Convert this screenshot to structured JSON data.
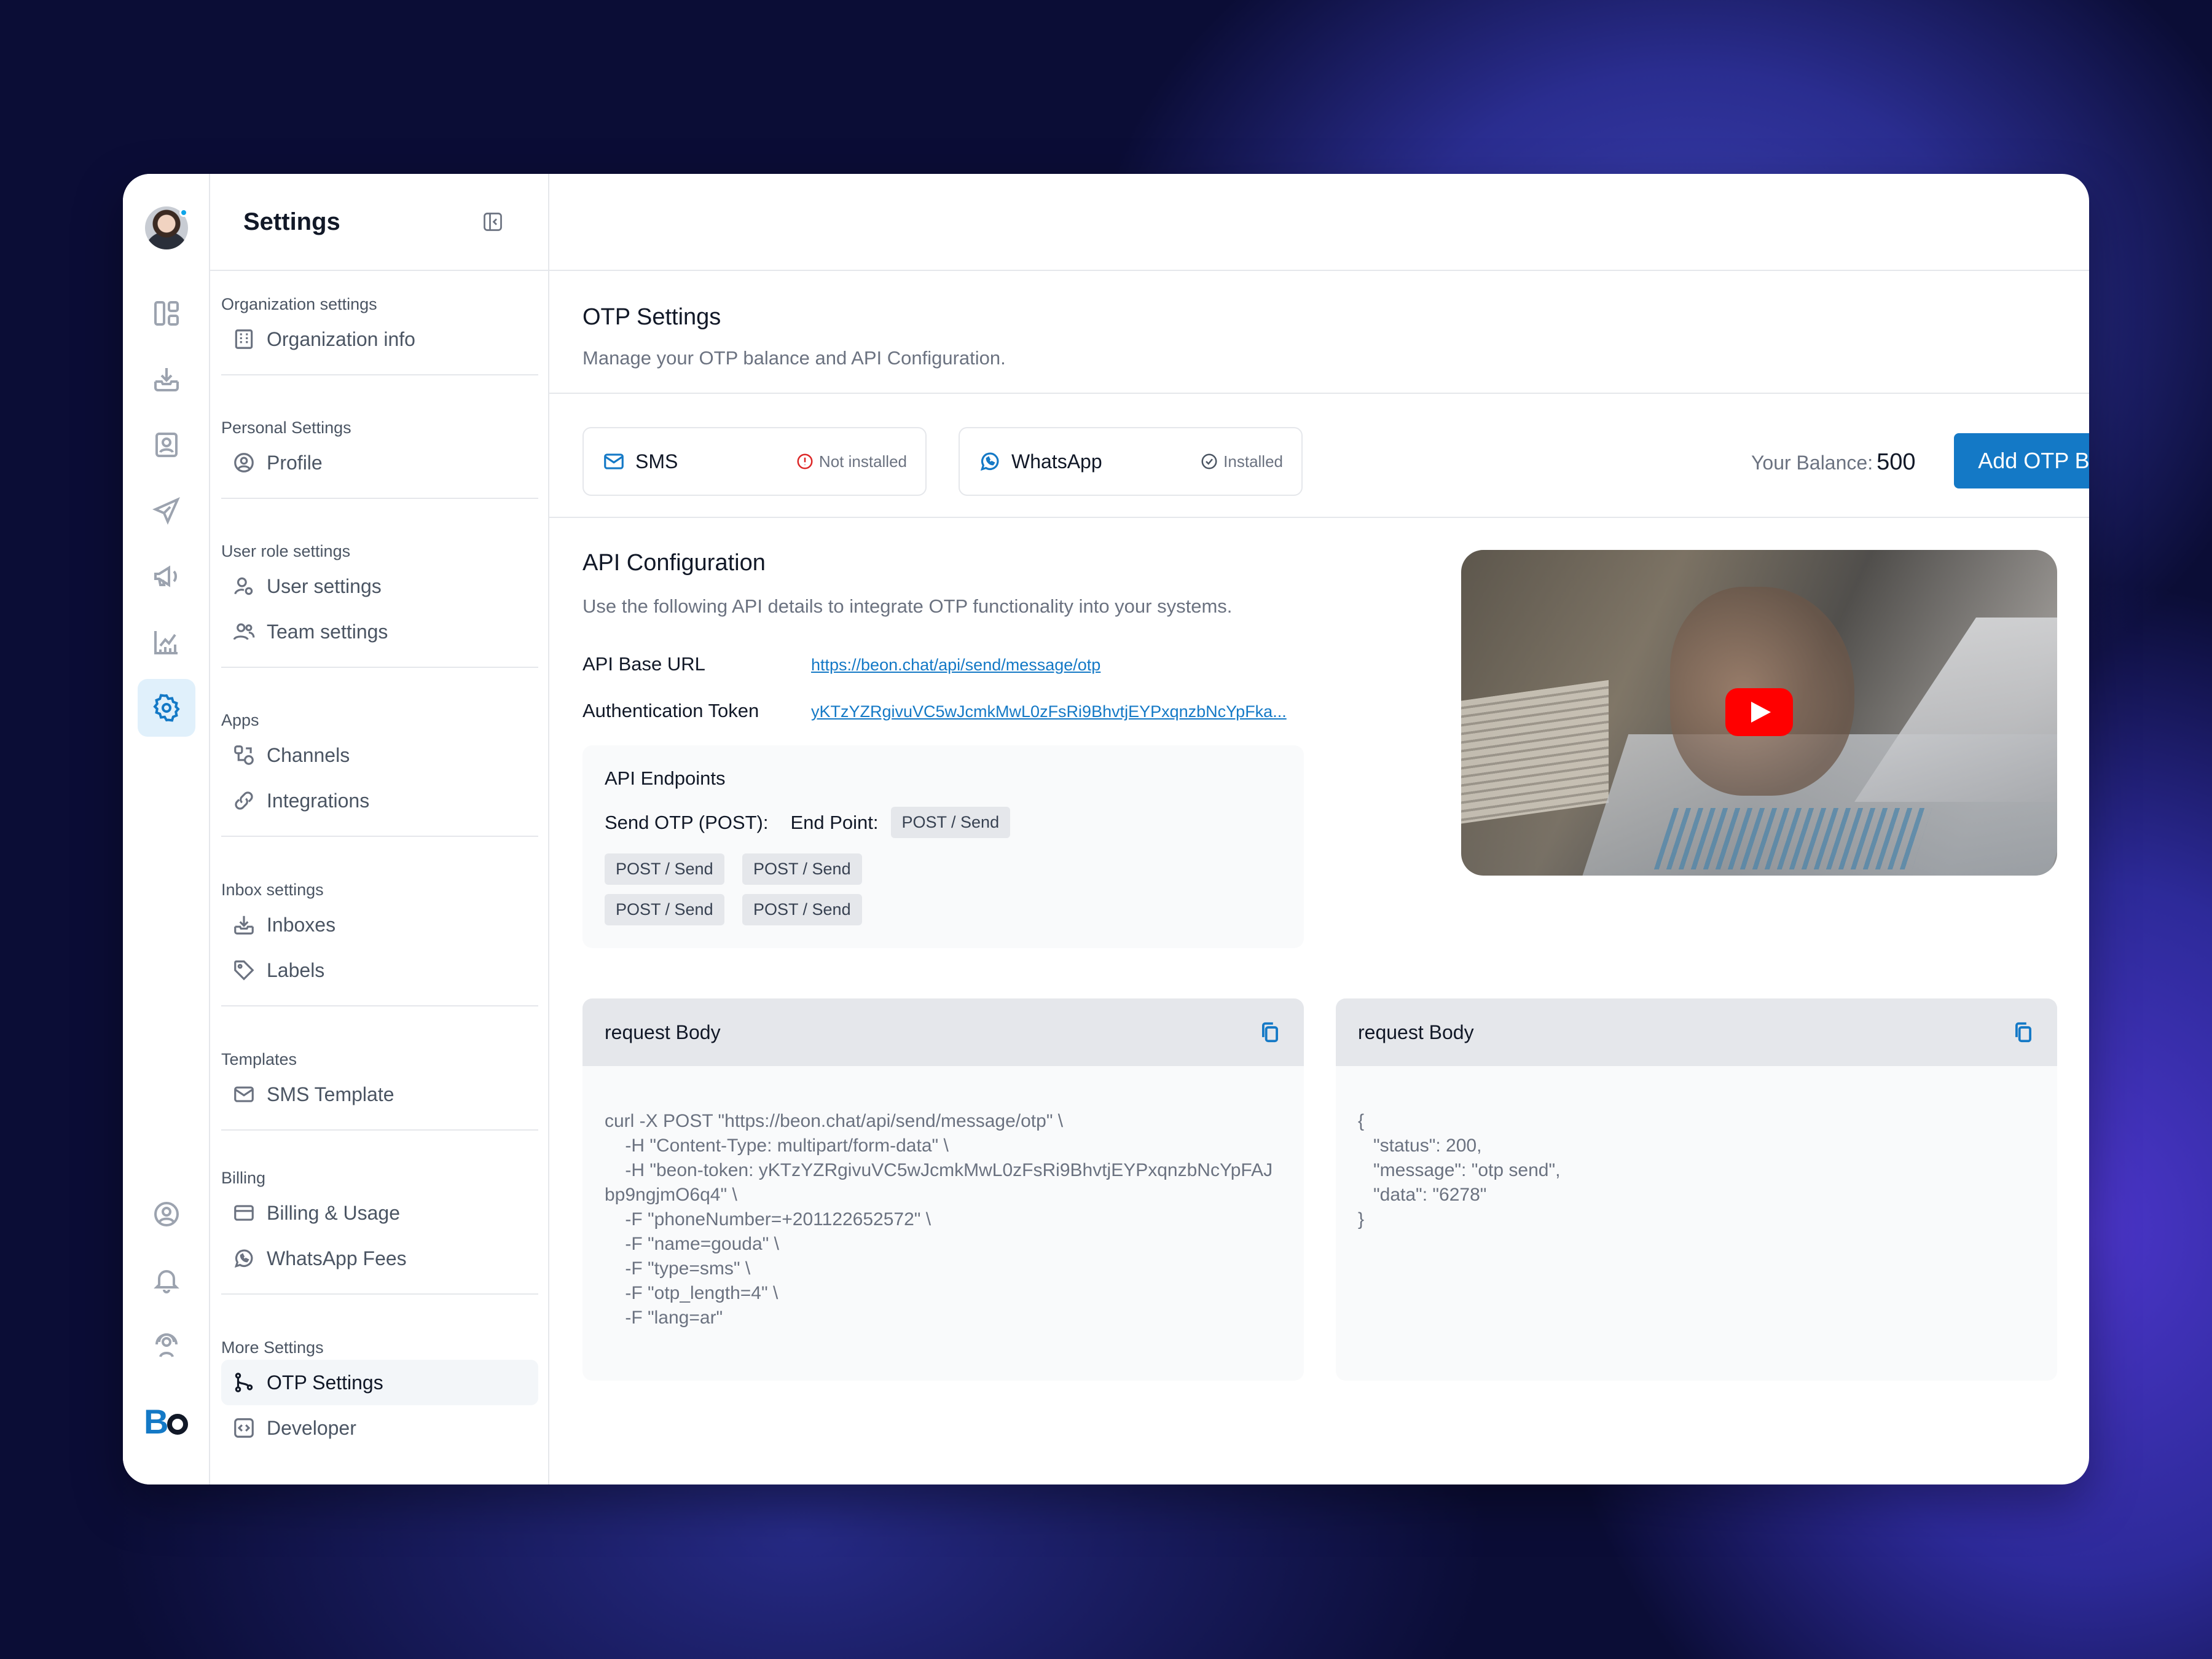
{
  "nav": {
    "title": "Settings",
    "sections": [
      {
        "label": "Organization settings",
        "items": [
          "Organization info"
        ]
      },
      {
        "label": "Personal Settings",
        "items": [
          "Profile"
        ]
      },
      {
        "label": "User role settings",
        "items": [
          "User settings",
          "Team settings"
        ]
      },
      {
        "label": "Apps",
        "items": [
          "Channels",
          "Integrations"
        ]
      },
      {
        "label": "Inbox settings",
        "items": [
          "Inboxes",
          "Labels"
        ]
      },
      {
        "label": "Templates",
        "items": [
          "SMS Template"
        ]
      },
      {
        "label": "Billing",
        "items": [
          "Billing & Usage",
          "WhatsApp Fees"
        ]
      },
      {
        "label": "More Settings",
        "items": [
          "OTP Settings",
          "Developer"
        ]
      }
    ]
  },
  "otp": {
    "title": "OTP Settings",
    "subtitle": "Manage your OTP balance and API Configuration."
  },
  "channels": {
    "sms": {
      "name": "SMS",
      "status": "Not installed"
    },
    "whatsapp": {
      "name": "WhatsApp",
      "status": "Installed"
    }
  },
  "balance": {
    "label": "Your Balance:",
    "value": "500",
    "button": "Add OTP Balance"
  },
  "api": {
    "title": "API Configuration",
    "subtitle": "Use the following API details to integrate OTP functionality into your systems.",
    "base_url_label": "API Base URL",
    "base_url": "https://beon.chat/api/send/message/otp",
    "token_label": "Authentication Token",
    "token": "yKTzYZRgivuVC5wJcmkMwL0zFsRi9BhvtjEYPxqnzbNcYpFka..."
  },
  "endpoints": {
    "title": "API Endpoints",
    "send_label": "Send OTP (POST):",
    "endpoint_label": "End Point:",
    "chips": [
      "POST / Send",
      "POST / Send",
      "POST / Send",
      "POST / Send",
      "POST / Send"
    ]
  },
  "request": {
    "title": "request Body",
    "code": "curl -X POST \"https://beon.chat/api/send/message/otp\" \\\n    -H \"Content-Type: multipart/form-data\" \\\n    -H \"beon-token: yKTzYZRgivuVC5wJcmkMwL0zFsRi9BhvtjEYPxqnzbNcYpFAJbp9ngjmO6q4\" \\\n    -F \"phoneNumber=+201122652572\" \\\n    -F \"name=gouda\" \\\n    -F \"type=sms\" \\\n    -F \"otp_length=4\" \\\n    -F \"lang=ar\""
  },
  "response": {
    "title": "request Body",
    "code": "{\n   \"status\": 200,\n   \"message\": \"otp send\",\n   \"data\": \"6278\"\n}"
  },
  "brand": {
    "accent": "#1479c6",
    "logo_letter": "B"
  }
}
